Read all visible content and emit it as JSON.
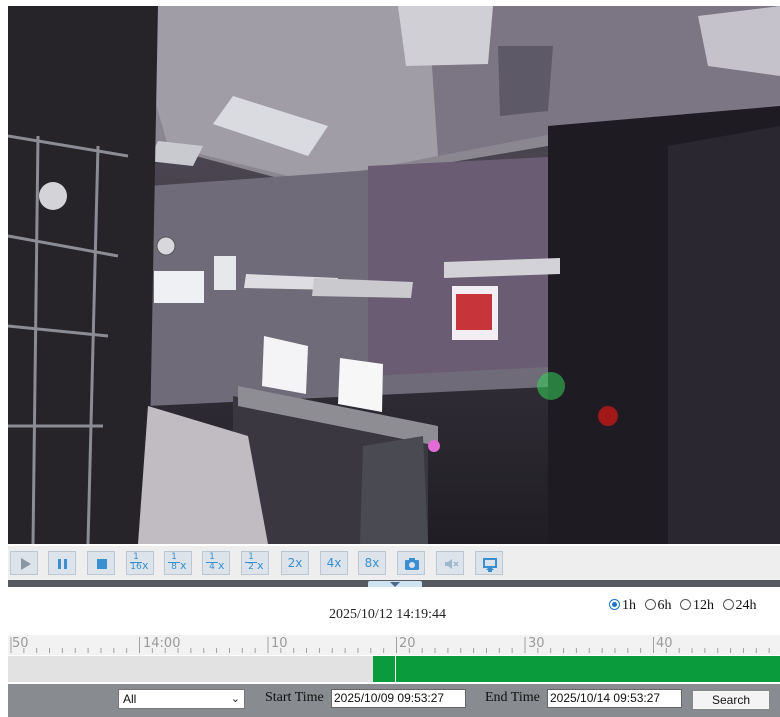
{
  "toolbar": {
    "buttons": [
      {
        "name": "play-button",
        "icon": "play-icon"
      },
      {
        "name": "pause-button",
        "icon": "pause-icon"
      },
      {
        "name": "stop-button",
        "icon": "stop-icon"
      },
      {
        "name": "speed-1-16-button",
        "num": "1",
        "den": "16",
        "x": "x"
      },
      {
        "name": "speed-1-8-button",
        "num": "1",
        "den": "8",
        "x": "x"
      },
      {
        "name": "speed-1-4-button",
        "num": "1",
        "den": "4",
        "x": "x"
      },
      {
        "name": "speed-1-2-button",
        "num": "1",
        "den": "2",
        "x": "x"
      },
      {
        "name": "speed-2x-button",
        "label": "2x"
      },
      {
        "name": "speed-4x-button",
        "label": "4x"
      },
      {
        "name": "speed-8x-button",
        "label": "8x"
      },
      {
        "name": "snapshot-button",
        "icon": "camera-icon"
      },
      {
        "name": "mute-button",
        "icon": "speaker-muted-icon"
      },
      {
        "name": "download-button",
        "icon": "download-icon"
      }
    ]
  },
  "timeinfo": {
    "current_datetime": "2025/10/12 14:19:44",
    "ranges": [
      {
        "label": "1h",
        "selected": true
      },
      {
        "label": "6h",
        "selected": false
      },
      {
        "label": "12h",
        "selected": false
      },
      {
        "label": "24h",
        "selected": false
      }
    ]
  },
  "ruler": {
    "labels": [
      "50",
      "14:00",
      "10",
      "20",
      "30",
      "40"
    ]
  },
  "timeline": {
    "recording_color": "#0a9b3d",
    "recording_start_fraction": 0.473,
    "cursor_fraction": 0.501
  },
  "search": {
    "filter_value": "All",
    "start_label": "Start Time",
    "start_value": "2025/10/09 09:53:27",
    "end_label": "End Time",
    "end_value": "2025/10/14 09:53:27",
    "button_label": "Search"
  },
  "colors": {
    "accent": "#3a8fd0",
    "toolbar_bg": "#eeeeee",
    "search_bar_bg": "#888b8f"
  }
}
